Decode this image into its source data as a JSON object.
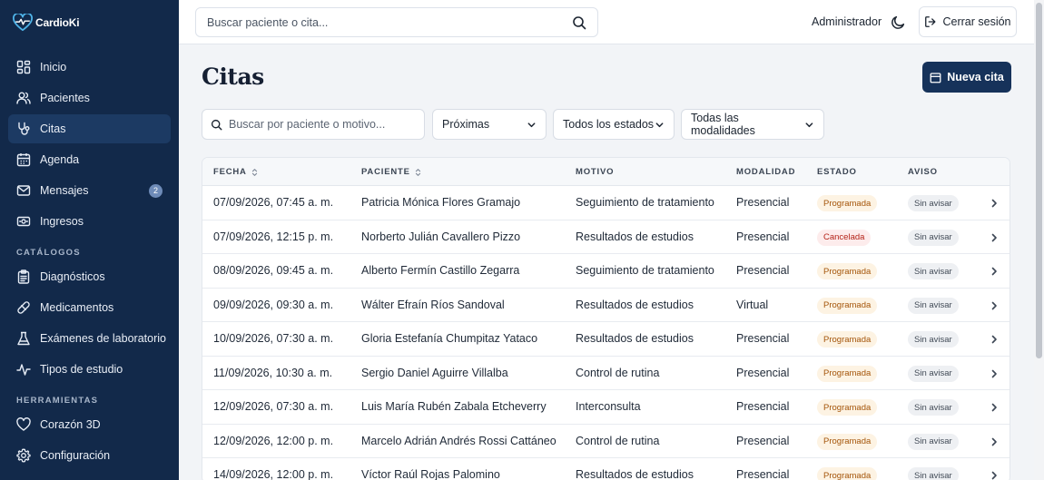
{
  "app": {
    "brand": "CardioKi"
  },
  "sidebar": {
    "items": [
      {
        "label": "Inicio"
      },
      {
        "label": "Pacientes"
      },
      {
        "label": "Citas"
      },
      {
        "label": "Agenda"
      },
      {
        "label": "Mensajes",
        "badge": "2"
      },
      {
        "label": "Ingresos"
      }
    ],
    "catalogos": {
      "title": "CATÁLOGOS",
      "items": [
        {
          "label": "Diagnósticos"
        },
        {
          "label": "Medicamentos"
        },
        {
          "label": "Exámenes de laboratorio"
        },
        {
          "label": "Tipos de estudio"
        }
      ]
    },
    "herramientas": {
      "title": "HERRAMIENTAS",
      "items": [
        {
          "label": "Corazón 3D"
        },
        {
          "label": "Configuración"
        }
      ]
    }
  },
  "topbar": {
    "search_placeholder": "Buscar paciente o cita...",
    "user": "Administrador",
    "logout": "Cerrar sesión"
  },
  "main": {
    "title": "Citas",
    "new_button": "Nueva cita",
    "filters": {
      "search_placeholder": "Buscar por paciente o motivo...",
      "period": "Próximas",
      "status": "Todos los estados",
      "modality": "Todas las modalidades"
    },
    "table": {
      "headers": {
        "fecha": "FECHA",
        "paciente": "PACIENTE",
        "motivo": "MOTIVO",
        "modalidad": "MODALIDAD",
        "estado": "ESTADO",
        "aviso": "AVISO"
      },
      "rows": [
        {
          "fecha": "07/09/2026, 07:45 a. m.",
          "paciente": "Patricia Mónica Flores Gramajo",
          "motivo": "Seguimiento de tratamiento",
          "modalidad": "Presencial",
          "estado": "Programada",
          "aviso": "Sin avisar"
        },
        {
          "fecha": "07/09/2026, 12:15 p. m.",
          "paciente": "Norberto Julián Cavallero Pizzo",
          "motivo": "Resultados de estudios",
          "modalidad": "Presencial",
          "estado": "Cancelada",
          "aviso": "Sin avisar"
        },
        {
          "fecha": "08/09/2026, 09:45 a. m.",
          "paciente": "Alberto Fermín Castillo Zegarra",
          "motivo": "Seguimiento de tratamiento",
          "modalidad": "Presencial",
          "estado": "Programada",
          "aviso": "Sin avisar"
        },
        {
          "fecha": "09/09/2026, 09:30 a. m.",
          "paciente": "Wálter Efraín Ríos Sandoval",
          "motivo": "Resultados de estudios",
          "modalidad": "Virtual",
          "estado": "Programada",
          "aviso": "Sin avisar"
        },
        {
          "fecha": "10/09/2026, 07:30 a. m.",
          "paciente": "Gloria Estefanía Chumpitaz Yataco",
          "motivo": "Resultados de estudios",
          "modalidad": "Presencial",
          "estado": "Programada",
          "aviso": "Sin avisar"
        },
        {
          "fecha": "11/09/2026, 10:30 a. m.",
          "paciente": "Sergio Daniel Aguirre Villalba",
          "motivo": "Control de rutina",
          "modalidad": "Presencial",
          "estado": "Programada",
          "aviso": "Sin avisar"
        },
        {
          "fecha": "12/09/2026, 07:30 a. m.",
          "paciente": "Luis María Rubén Zabala Etcheverry",
          "motivo": "Interconsulta",
          "modalidad": "Presencial",
          "estado": "Programada",
          "aviso": "Sin avisar"
        },
        {
          "fecha": "12/09/2026, 12:00 p. m.",
          "paciente": "Marcelo Adrián Andrés Rossi Cattáneo",
          "motivo": "Control de rutina",
          "modalidad": "Presencial",
          "estado": "Programada",
          "aviso": "Sin avisar"
        },
        {
          "fecha": "14/09/2026, 12:00 p. m.",
          "paciente": "Víctor Raúl Rojas Palomino",
          "motivo": "Resultados de estudios",
          "modalidad": "Presencial",
          "estado": "Programada",
          "aviso": "Sin avisar"
        }
      ]
    }
  },
  "colors": {
    "sidebar": "#12294a",
    "primary": "#16325a",
    "programada": "#a4550a",
    "cancelada": "#b42318"
  }
}
